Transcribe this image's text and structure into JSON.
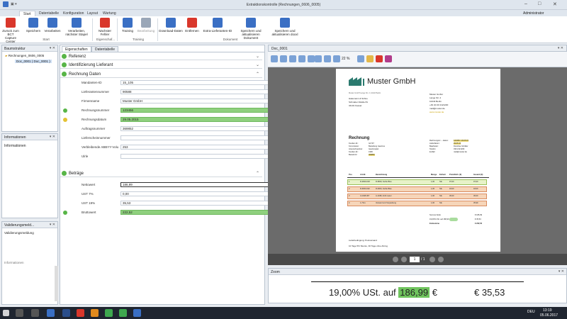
{
  "window": {
    "title": "Extraktionskontrolle (Rechnungen_0606_0005)",
    "user": "Administrator"
  },
  "ribbon_tabs": [
    "Start",
    "Datentabelle",
    "Konfiguration",
    "Layout",
    "Wartung"
  ],
  "ribbon": {
    "buttons": [
      {
        "label": "Zurück zum BCT Capture Center",
        "icon": "back-icon",
        "color": "#d9372b"
      },
      {
        "label": "Speichern",
        "icon": "save-icon",
        "color": "#3a6fc4"
      },
      {
        "label": "Verarbeiten",
        "icon": "process-icon",
        "color": "#3a6fc4"
      },
      {
        "label": "Verarbeiten, nächster Stapel",
        "icon": "process-next-icon",
        "color": "#3a6fc4"
      },
      {
        "label": "Nächster Fehler",
        "icon": "next-error-icon",
        "color": "#d9372b"
      },
      {
        "label": "Training",
        "icon": "training-icon",
        "color": "#3a6fc4"
      },
      {
        "label": "Bearbeitung",
        "icon": "edit-icon",
        "color": "#9aa7b8"
      },
      {
        "label": "Download-Daten",
        "icon": "download-icon",
        "color": "#3a6fc4"
      },
      {
        "label": "Entfernen",
        "icon": "remove-icon",
        "color": "#d9372b"
      },
      {
        "label": "Extra-Lieferanten-ID",
        "icon": "supplier-id-icon",
        "color": "#3a6fc4"
      },
      {
        "label": "Speichern und aktualisieren Dokument",
        "icon": "save-refresh-icon",
        "color": "#3a6fc4"
      },
      {
        "label": "Speichern und aktualisieren doxxl",
        "icon": "save-doxxl-icon",
        "color": "#3a6fc4"
      }
    ],
    "groups": [
      "Start",
      "Eigenschaf...",
      "Training",
      "Dokument"
    ]
  },
  "tree": {
    "title": "Baumstruktur",
    "items": [
      "Rechnungen_0606_0005",
      "Doc_0001 ( Doc_0001 )"
    ]
  },
  "info_panel": {
    "title": "Informationen",
    "label": "Informationen"
  },
  "validation_panel": {
    "title": "Validierungsmeld...",
    "label": "Validierungsmeldung",
    "footer": "Informationen"
  },
  "center_tabs": [
    "Eigenschaften",
    "Datentabelle"
  ],
  "sections": {
    "referenz": "Referenz",
    "identifizierung": "Identifizierung Lieferant",
    "rechnung": "Rechnung Daten",
    "betraege": "Beträge"
  },
  "fields": [
    {
      "label": "Mandanten-ID",
      "value": "15_105",
      "green": false,
      "status": ""
    },
    {
      "label": "Lieferantennummer",
      "value": "90588",
      "green": false,
      "status": ""
    },
    {
      "label": "Firmenname",
      "value": "Muster GmbH",
      "green": false,
      "status": ""
    },
    {
      "label": "Rechnungsnummer",
      "value": "123456",
      "green": true,
      "status": "ok"
    },
    {
      "label": "Rechnungsdatum",
      "value": "29.05.2015",
      "green": true,
      "status": "warn"
    },
    {
      "label": "Auftragsnummer",
      "value": "369852",
      "green": false,
      "status": ""
    },
    {
      "label": "Lieferscheinnummer",
      "value": "",
      "green": false,
      "status": ""
    },
    {
      "label": "Verbleibende ABBYY-Volu",
      "value": "253",
      "green": false,
      "status": ""
    },
    {
      "label": "Ulrle",
      "value": "",
      "green": false,
      "status": ""
    }
  ],
  "amounts": [
    {
      "label": "Nettowert",
      "value": "186,99",
      "green": false,
      "status": ""
    },
    {
      "label": "UST 7%",
      "value": "0,00",
      "green": false,
      "status": ""
    },
    {
      "label": "UST 19%",
      "value": "35,53",
      "green": false,
      "status": ""
    },
    {
      "label": "Bruttowert",
      "value": "222,52",
      "green": true,
      "status": "ok"
    }
  ],
  "doc": {
    "tab": "Doc_0001",
    "zoom": "22 %",
    "page": "1",
    "pages": "/ 1"
  },
  "invoice": {
    "company": "Muster GmbH",
    "sender_line": "Muster GmbH Lange Str. 2, 10243 Berlin",
    "recipient": [
      "Hakemann & Söhne",
      "Schnatter-Straße 81",
      "34131 Kassel"
    ],
    "sender": [
      "Muster GmbH",
      "Lange Str. 2",
      "10243 Berlin",
      "+49 (0) 30 2121200",
      "mail@muster.de",
      "www.muster.de"
    ],
    "title": "Rechnung",
    "meta_left": [
      "Kunden-Nr.:",
      "Kommission:",
      "Ansprechpartner:",
      "Kunden-Nr.:",
      "Bestell-Nr.:"
    ],
    "meta_left_vals": [
      "G1707",
      "Bestellung Gewinne",
      "Gewinnspiel",
      "1996",
      "369852"
    ],
    "meta_right": [
      "Rechnungsnr. – datum:",
      "Lieferdatum:",
      "Bearbeiter:",
      "Telefon:",
      "E-Mail:"
    ],
    "meta_right_vals": [
      "123456 / 29.05.15",
      "29.05.15",
      "Dorothee Schäfer",
      "030 2121209",
      "mail@muster.de"
    ],
    "headers": [
      "Pos",
      "Art-Nr.",
      "Bezeichnung",
      "Menge",
      "Einheit",
      "Preis/Einh. (€)",
      "Gesamt (€)"
    ],
    "rows": [
      [
        "1",
        "R-2829-018",
        "R-9829, Farbe Bleu",
        "1,00",
        "Stk",
        "97,00",
        "97,00"
      ],
      [
        "2",
        "R-6000-032",
        "R-6000, Farbe Blau",
        "1,00",
        "Stk",
        "18,00",
        "18,00"
      ],
      [
        "3",
        "4-1048-007",
        "A-1048, Arzik Lasur",
        "1,00",
        "Stk",
        "36,00",
        "36,00"
      ],
      [
        "4",
        "1-73xx",
        "Versand und Verpackung",
        "1,00",
        "Stk",
        "",
        "35,99"
      ]
    ],
    "totals_labels": [
      "Summe Netto",
      "19,00% USt. auf 186,99",
      "Endsumme"
    ],
    "totals": [
      "€ 186,99",
      "€ 35,53",
      "€ 222,52"
    ],
    "footer": [
      "Lieferbedingung: Postversand",
      "10 Tage 5% Skonto, 30 Tage ohne Abzug"
    ]
  },
  "zoom_panel": {
    "title": "Zoom",
    "text_pre": "19,00% USt. auf",
    "highlight": "186,99",
    "text_post": "€",
    "amount": "€ 35,53"
  },
  "taskbar": {
    "time": "13:19",
    "date": "05.06.2017",
    "lang": "DEU"
  }
}
